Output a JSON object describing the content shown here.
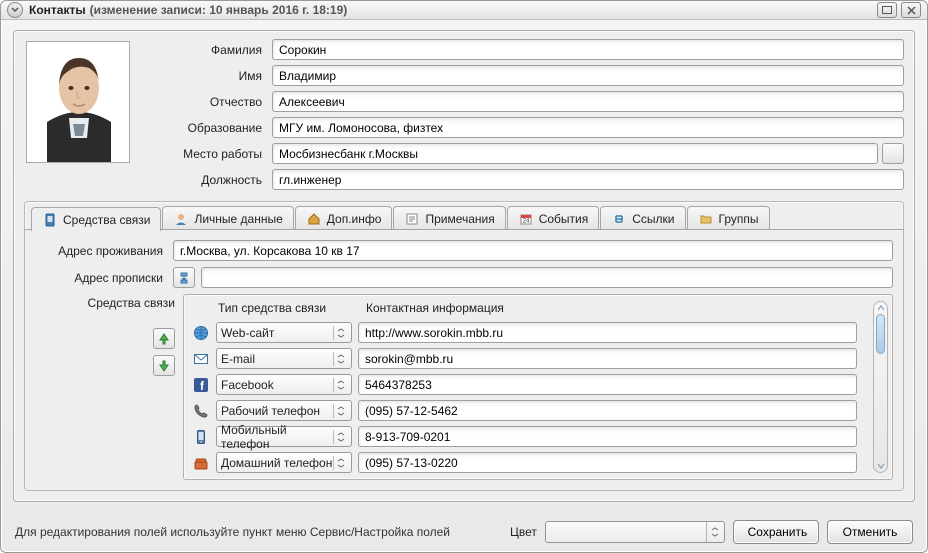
{
  "window": {
    "title": "Контакты",
    "subtitle": "(изменение записи: 10 январь 2016 г. 18:19)"
  },
  "fields": {
    "surname_label": "Фамилия",
    "surname": "Сорокин",
    "name_label": "Имя",
    "name": "Владимир",
    "patronymic_label": "Отчество",
    "patronymic": "Алексеевич",
    "education_label": "Образование",
    "education": "МГУ им. Ломоносова, физтех",
    "work_label": "Место работы",
    "work": "Мосбизнесбанк г.Москвы",
    "position_label": "Должность",
    "position": "гл.инженер"
  },
  "tabs": {
    "communications": "Средства связи",
    "personal": "Личные данные",
    "extra": "Доп.инфо",
    "notes": "Примечания",
    "events": "События",
    "links": "Ссылки",
    "groups": "Группы"
  },
  "address": {
    "living_label": "Адрес проживания",
    "living": "г.Москва, ул. Корсакова 10 кв 17",
    "reg_label": "Адрес прописки",
    "reg": ""
  },
  "comms": {
    "label": "Средства связи",
    "header_type": "Тип средства связи",
    "header_info": "Контактная информация",
    "rows": [
      {
        "icon": "globe-icon",
        "type": "Web-сайт",
        "info": "http://www.sorokin.mbb.ru"
      },
      {
        "icon": "mail-icon",
        "type": "E-mail",
        "info": "sorokin@mbb.ru"
      },
      {
        "icon": "facebook-icon",
        "type": "Facebook",
        "info": "5464378253"
      },
      {
        "icon": "phone-icon",
        "type": "Рабочий телефон",
        "info": "(095) 57-12-5462"
      },
      {
        "icon": "mobile-icon",
        "type": "Мобильный телефон",
        "info": "8-913-709-0201"
      },
      {
        "icon": "home-phone-icon",
        "type": "Домашний телефон",
        "info": "(095) 57-13-0220"
      }
    ]
  },
  "footer": {
    "hint": "Для редактирования полей используйте пункт меню Сервис/Настройка полей",
    "color_label": "Цвет",
    "save": "Сохранить",
    "cancel": "Отменить"
  }
}
